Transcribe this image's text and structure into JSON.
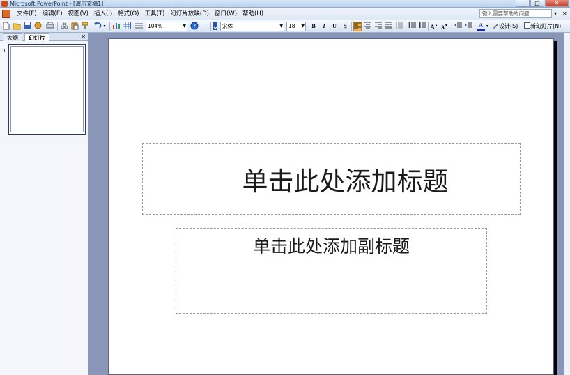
{
  "window": {
    "title": "Microsoft PowerPoint - [演示文稿1]",
    "controls": [
      "_",
      "□",
      "✕"
    ]
  },
  "menu": {
    "items": [
      "文件(F)",
      "编辑(E)",
      "视图(V)",
      "插入(I)",
      "格式(O)",
      "工具(T)",
      "幻灯片放映(D)",
      "窗口(W)",
      "帮助(H)"
    ],
    "help_placeholder": "键入需要帮助的问题",
    "help_arrow": "▾",
    "doc_close": "✕"
  },
  "toolbar": {
    "zoom": "104%",
    "font": "宋体",
    "font_size": "18",
    "bold": "B",
    "italic": "I",
    "underline": "U",
    "shadow": "S",
    "font_color_glyph": "A",
    "design_label": "设计(S)",
    "new_slide_label": "新幻灯片(N)"
  },
  "left_pane": {
    "tabs": [
      "大纲",
      "幻灯片"
    ],
    "selected_tab": 1,
    "close": "✕",
    "slides": [
      {
        "number": "1"
      }
    ]
  },
  "slide": {
    "title_placeholder": "单击此处添加标题",
    "subtitle_placeholder": "单击此处添加副标题"
  },
  "colors": {
    "workspace": "#8a96b8",
    "accent_active": "#f2b24a",
    "font_color": "#1a2ea8"
  }
}
